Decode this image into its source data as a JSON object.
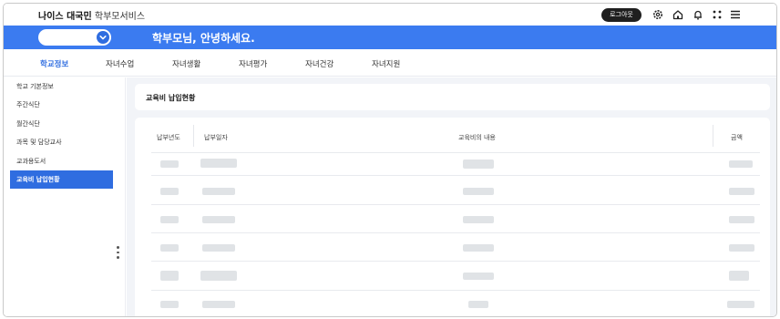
{
  "app": {
    "brand_bold": "나이스 대국민",
    "brand_regular": "학부모서비스",
    "logout_label": "로그아웃",
    "icons": [
      "gear-icon",
      "home-icon",
      "bell-icon",
      "apps-icon",
      "menu-icon"
    ],
    "accent_color": "#3b7bf0"
  },
  "header": {
    "greeting": "학부모님, 안녕하세요."
  },
  "nav": {
    "tabs": [
      {
        "label": "학교정보",
        "active": true
      },
      {
        "label": "자녀수업",
        "active": false
      },
      {
        "label": "자녀생활",
        "active": false
      },
      {
        "label": "자녀평가",
        "active": false
      },
      {
        "label": "자녀건강",
        "active": false
      },
      {
        "label": "자녀지원",
        "active": false
      }
    ]
  },
  "sidebar": {
    "items": [
      {
        "label": "학교 기본정보",
        "active": false
      },
      {
        "label": "주간식단",
        "active": false
      },
      {
        "label": "월간식단",
        "active": false
      },
      {
        "label": "과목 및 담당교사",
        "active": false
      },
      {
        "label": "교과용도서",
        "active": false
      },
      {
        "label": "교육비 납입현황",
        "active": true
      }
    ]
  },
  "main": {
    "section_title": "교육비 납입현황",
    "table": {
      "columns": [
        "납부년도",
        "납부일자",
        "교육비의 내용",
        "금액"
      ],
      "rows_note_hidden": true
    }
  }
}
